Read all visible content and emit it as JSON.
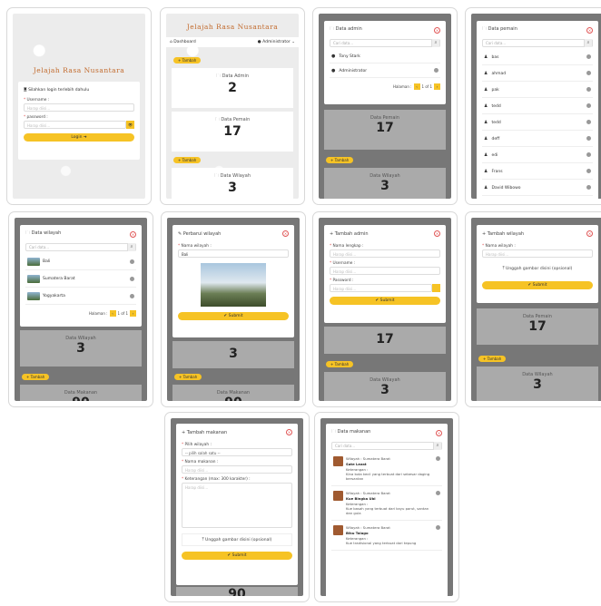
{
  "app_title": "Jelajah Rasa Nusantara",
  "colors": {
    "accent": "#f6c325",
    "danger": "#e05555",
    "brand": "#c26a2c"
  },
  "login": {
    "prompt": "Silahkan login terlebih dahulu",
    "username_label": "Username :",
    "username_ph": "Harap diisi...",
    "password_label": "password :",
    "password_ph": "Harap diisi...",
    "login_btn": "Login ➜"
  },
  "dashboard": {
    "nav_dashboard": "Dashboard",
    "nav_admin": "Administrator",
    "tambah": "+ Tambah",
    "admin_label": "Data Admin",
    "admin_value": "2",
    "pemain_label": "Data Pemain",
    "pemain_value": "17",
    "wilayah_label": "Data Wilayah",
    "wilayah_value": "3",
    "makanan_label": "Data Makanan",
    "makanan_value": "90"
  },
  "admin_modal": {
    "title": "Data admin",
    "search_ph": "Cari data...",
    "rows": [
      "Tony Stark",
      "Administrator"
    ],
    "halaman": "Halaman :",
    "page_info": "1 of 1"
  },
  "pemain_modal": {
    "title": "Data pemain",
    "search_ph": "Cari data...",
    "rows": [
      "bas",
      "ahmad",
      "pak",
      "tedd",
      "tedd",
      "deff",
      "edi",
      "Frans",
      "David Wibowo"
    ]
  },
  "wilayah_modal": {
    "title": "Data wilayah",
    "search_ph": "Cari data...",
    "rows": [
      "Bali",
      "Sumatera Barat",
      "Yogyakarta"
    ],
    "halaman": "Halaman :",
    "page_info": "1 of 1"
  },
  "edit_wilayah": {
    "title": "Perbarui wilayah",
    "label": "Nama wilayah :",
    "value": "Bali",
    "submit": "✔ Submit"
  },
  "tambah_admin": {
    "title": "+ Tambah admin",
    "f1": "Nama lengkap :",
    "f2": "Username :",
    "f3": "Password :",
    "ph": "Harap diisi...",
    "submit": "✔ Submit"
  },
  "tambah_wilayah": {
    "title": "+ Tambah wilayah",
    "f1": "Nama wilayah :",
    "ph": "Harap diisi...",
    "upload": "⤒ Unggah gambar disini (opsional)",
    "submit": "✔ Submit"
  },
  "tambah_makanan": {
    "title": "+ Tambah makanan",
    "f1": "Pilih wilayah :",
    "f1v": "-- pilih salah satu --",
    "f2": "Nama makanan :",
    "f3": "Keterangan (max: 300 karakter) :",
    "ph": "Harap diisi...",
    "upload": "⤒ Unggah gambar disini (opsional)",
    "submit": "✔ Submit"
  },
  "makanan_modal": {
    "title": "Data makanan",
    "search_ph": "Cari data...",
    "items": [
      {
        "wil": "Wilayah : Sumatera Barat",
        "name": "Sate Lezat",
        "ket": "Keterangan :",
        "desc": "Kina kota kecil yang terbuat dari sebesar daging bersantan"
      },
      {
        "wil": "Wilayah : Sumatera Barat",
        "name": "Kue Bingka Ubi",
        "ket": "Keterangan :",
        "desc": "Kue basah yang terbuat dari kayu parut, santan dan gula"
      },
      {
        "wil": "Wilayah : Sumatera Barat",
        "name": "Biku Talago",
        "ket": "Keterangan :",
        "desc": "Kue tradisional yang terbuat dari tepung"
      }
    ]
  }
}
